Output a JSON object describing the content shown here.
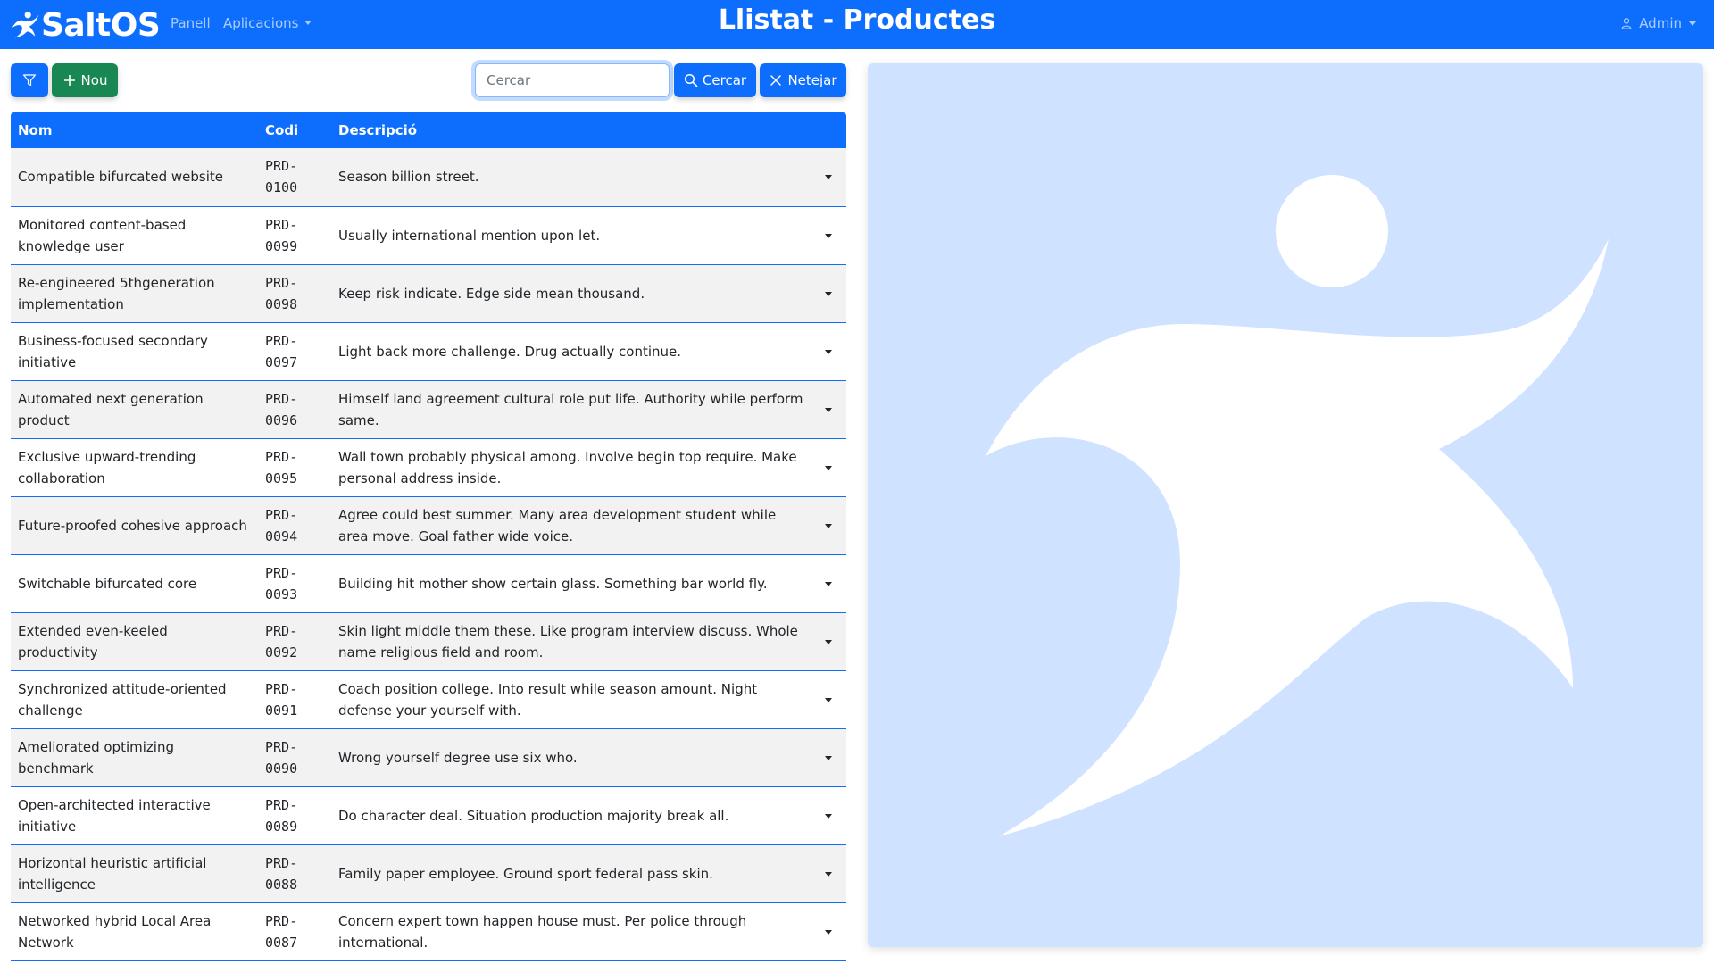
{
  "navbar": {
    "brand": "SaltOS",
    "links": [
      "Panell",
      "Aplicacions"
    ],
    "title": "Llistat - Productes",
    "user": "Admin",
    "logo_icon": "saltos-figure-icon"
  },
  "toolbar": {
    "filter_icon": "filter-icon",
    "new_label": "Nou",
    "search_placeholder": "Cercar",
    "search_value": "",
    "search_label": "Cercar",
    "clear_label": "Netejar"
  },
  "table": {
    "headers": [
      "Nom",
      "Codi",
      "Descripció"
    ],
    "rows": [
      {
        "nom": "Compatible bifurcated website",
        "codi": [
          "PRD-",
          "0100"
        ],
        "desc": "Season billion street."
      },
      {
        "nom": "Monitored content-based knowledge user",
        "codi": [
          "PRD-",
          "0099"
        ],
        "desc": "Usually international mention upon let."
      },
      {
        "nom": "Re-engineered 5thgeneration implementation",
        "codi": [
          "PRD-",
          "0098"
        ],
        "desc": "Keep risk indicate. Edge side mean thousand."
      },
      {
        "nom": "Business-focused secondary initiative",
        "codi": [
          "PRD-",
          "0097"
        ],
        "desc": "Light back more challenge. Drug actually continue."
      },
      {
        "nom": "Automated next generation product",
        "codi": [
          "PRD-",
          "0096"
        ],
        "desc": "Himself land agreement cultural role put life. Authority while perform same."
      },
      {
        "nom": "Exclusive upward-trending collaboration",
        "codi": [
          "PRD-",
          "0095"
        ],
        "desc": "Wall town probably physical among. Involve begin top require. Make personal address inside."
      },
      {
        "nom": "Future-proofed cohesive approach",
        "codi": [
          "PRD-",
          "0094"
        ],
        "desc": "Agree could best summer. Many area development student while area move. Goal father wide voice."
      },
      {
        "nom": "Switchable bifurcated core",
        "codi": [
          "PRD-",
          "0093"
        ],
        "desc": "Building hit mother show certain glass. Something bar world fly."
      },
      {
        "nom": "Extended even-keeled productivity",
        "codi": [
          "PRD-",
          "0092"
        ],
        "desc": "Skin light middle them these. Like program interview discuss. Whole name religious field and room."
      },
      {
        "nom": "Synchronized attitude-oriented challenge",
        "codi": [
          "PRD-",
          "0091"
        ],
        "desc": "Coach position college. Into result while season amount. Night defense your yourself with."
      },
      {
        "nom": "Ameliorated optimizing benchmark",
        "codi": [
          "PRD-",
          "0090"
        ],
        "desc": "Wrong yourself degree use six who."
      },
      {
        "nom": "Open-architected interactive initiative",
        "codi": [
          "PRD-",
          "0089"
        ],
        "desc": "Do character deal. Situation production majority break all."
      },
      {
        "nom": "Horizontal heuristic artificial intelligence",
        "codi": [
          "PRD-",
          "0088"
        ],
        "desc": "Family paper employee. Ground sport federal pass skin."
      },
      {
        "nom": "Networked hybrid Local Area Network",
        "codi": [
          "PRD-",
          "0087"
        ],
        "desc": "Concern expert town happen house must. Per police through international."
      }
    ]
  },
  "colors": {
    "primary": "#0d6efd",
    "success": "#198754",
    "panel": "#cfe2ff",
    "row_striped": "#f2f2f2"
  }
}
